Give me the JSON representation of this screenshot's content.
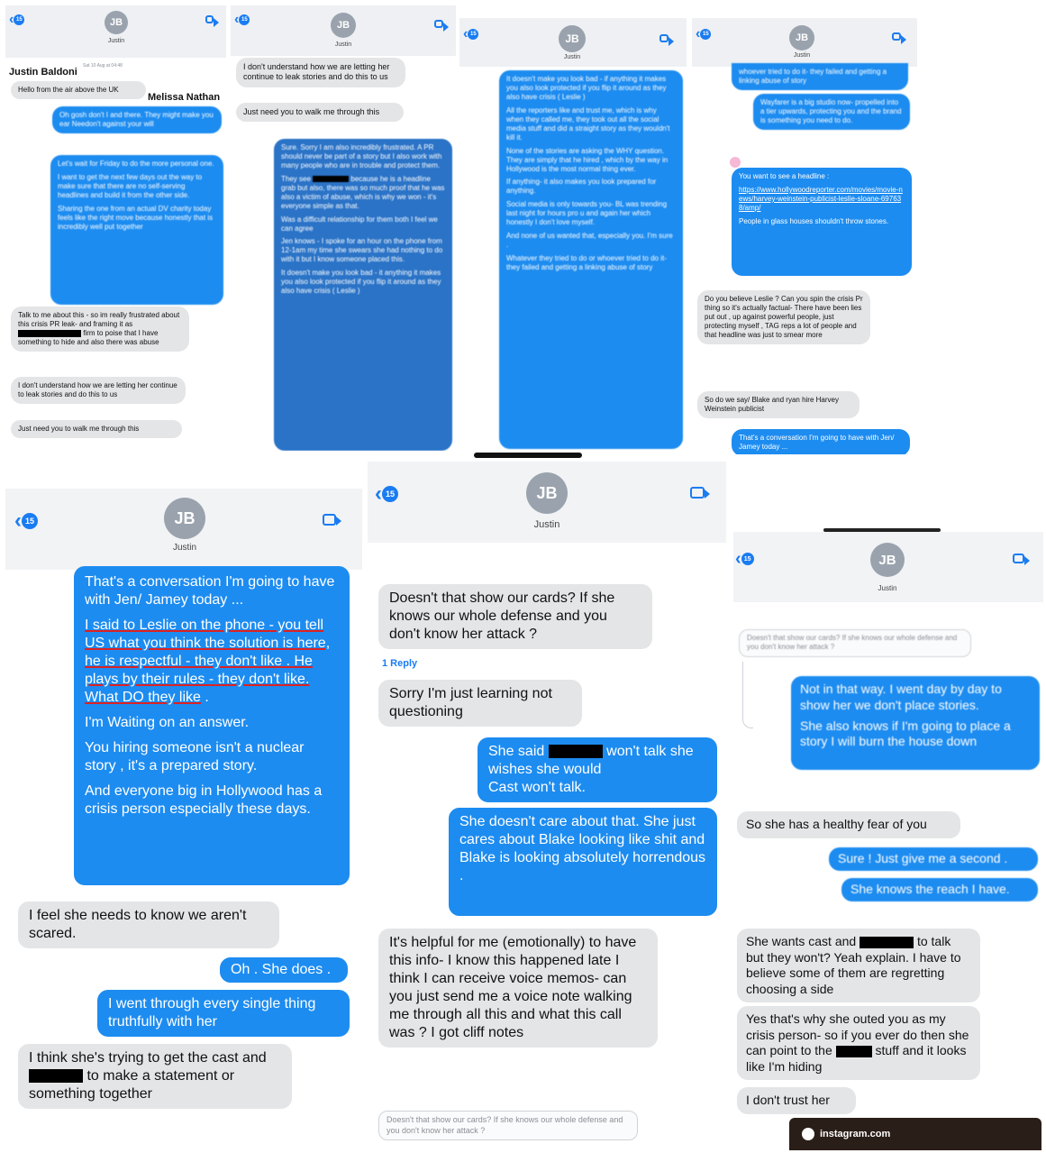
{
  "contact": {
    "initials": "JB",
    "name": "Justin"
  },
  "badge_count": "15",
  "panel1": {
    "sender_label": "Justin Baldoni",
    "recipient_label": "Melissa Nathan",
    "timestamp": "Sat 10 Aug at 04:48",
    "msgs": {
      "m1": "Hello from the air above the UK",
      "m2": "Oh gosh don't I and there. They might make you ear Needon't against your will",
      "m3a": "Let's wait for Friday to do the more personal one.",
      "m3b": "I want to get the next few days out the way to make sure that there are no self-serving headlines and build it from the other side.",
      "m3c": "Sharing the one from an actual DV charity today feels like the right move because honestly that is incredibly well put together",
      "m4a": "Talk to me about this - so im really frustrated about this crisis PR leak- and framing it as",
      "m4b": "firm to poise that I have something to hide and also there was abuse",
      "m5": "I don't understand how we are letting her continue to leak stories and do this to us",
      "m6": "Just need you to walk me through this"
    }
  },
  "panel2": {
    "msgs": {
      "m1": "I don't understand how we are letting her continue to leak stories and do this to us",
      "m2": "Just need you to walk me through this",
      "m3a": "Sure. Sorry I am also incredibly frustrated. A PR should never be part of a story but I also work with many people who are in trouble and protect them.",
      "m3b1": "They see",
      "m3b2": "because he is a headline grab but also, there was so much proof that he was also a victim of abuse, which is why we won - it's everyone simple as that.",
      "m3c": "Was a difficult relationship for them both I feel we can agree",
      "m3d": "Jen knows - I spoke for an hour on the phone from 12-1am my time she swears she had nothing to do with it but I know someone placed this.",
      "m3e": "It doesn't make you look bad - it anything it makes you also look protected if you flip it around as they also have crisis ( Leslie )"
    }
  },
  "panel3": {
    "msgs": {
      "a": "It doesn't make you look bad - if anything it makes you also look protected if you flip it around as they also have crisis ( Leslie )",
      "b": "All the reporters like and trust me, which is why when they called me, they took out all the social media stuff and did a straight story as they wouldn't kill it.",
      "c": "None of the stories are asking the WHY question. They are simply that he hired , which by the way in Hollywood is the most normal thing ever.",
      "d": "If anything- it also makes you look prepared for anything.",
      "e": "Social media is only towards you- BL was trending last night for hours pro u and again her which honestly I don't love myself.",
      "f": "And none of us wanted that, especially you. I'm sure .",
      "g": "Whatever they tried to do or whoever tried to do it- they failed and getting a linking abuse of story"
    }
  },
  "panel4": {
    "msgs": {
      "a": "whoever tried to do it- they failed and getting a linking abuse of story",
      "b": "Wayfarer is a big studio now- propelled into a tier upwards, protecting you and the brand is something you need to do.",
      "c1": "You want to see a headline :",
      "c2": "https://www.hollywoodreporter.com/movies/movie-news/harvey-weinstein-publicist-leslie-sloane-697638/amp/",
      "c3": "People in glass houses  shouldn't throw stones.",
      "d": "Do you believe Leslie ? Can you spin the crisis Pr thing so it's actually factual- There have been lies put out , up against powerful people, just protecting myself , TAG reps a lot of people and that headline was just to smear more",
      "e": "So do we say/ Blake and ryan hire Harvey Weinstein publicist",
      "f": "That's a conversation I'm going to have with Jen/ Jamey today ..."
    }
  },
  "panel5": {
    "msgs": {
      "a1": "That's a conversation I'm going to have with Jen/ Jamey today ...",
      "a2": "I said to Leslie on the phone - you tell US what you think the solution is here, he is respectful - they don't like . He plays by their rules - they don't like. What DO they like",
      "a2end": " .",
      "a3": "I'm Waiting on an answer.",
      "a4": "You hiring someone isn't a nuclear story , it's a prepared story.",
      "a5": "And everyone big in Hollywood has a crisis person especially these days.",
      "b": "I feel she needs to know we aren't scared.",
      "c": "Oh . She does .",
      "d": "I went through every single thing truthfully with her",
      "e1": "I think she's trying to get the cast and",
      "e2": "to make a statement or something together"
    }
  },
  "panel6": {
    "reply_label": "1 Reply",
    "msgs": {
      "a": "Doesn't that show our cards? If she knows our whole defense and you don't know her attack ?",
      "b": "Sorry I'm just learning not questioning",
      "c1": "She said",
      "c2": "won't talk she wishes she would",
      "c3": "Cast won't talk.",
      "d": "She doesn't care about that. She just cares about Blake looking like shit and Blake is looking absolutely horrendous .",
      "e": "It's helpful for me (emotionally) to have this info- I know this happened late I think I can receive voice memos- can you just send me a voice note walking me through all this and what this call was ? I got cliff notes",
      "quote": "Doesn't that show our cards? If she knows our whole defense and you don't know her attack ?"
    }
  },
  "panel7": {
    "footer": "instagram.com",
    "msgs": {
      "quote": "Doesn't that show our cards? If she knows our whole defense and you don't know her attack ?",
      "a1": "Not in that way. I went day by day to show her we don't place stories.",
      "a2": "She also knows if I'm going to place a story I will burn the house down",
      "b": "So she has a healthy fear of you",
      "c": "Sure ! Just give me a second .",
      "d": "She knows the reach I have.",
      "e1": "She wants cast and",
      "e2": "to talk but they won't? Yeah explain. I have to believe some of them are regretting choosing a side",
      "f1": "Yes that's why she outed you as my crisis person- so if you ever do then she can point to the",
      "f2": "stuff and it looks like I'm hiding",
      "g": "I don't trust her"
    }
  }
}
